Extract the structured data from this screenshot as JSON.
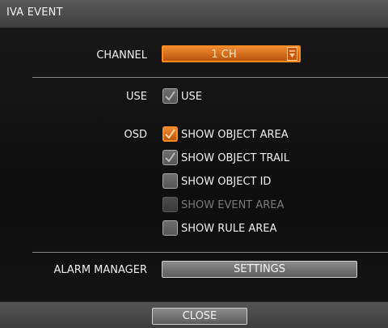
{
  "window": {
    "title": "IVA EVENT"
  },
  "channel": {
    "label": "CHANNEL",
    "value": "1 CH",
    "icon": "dropdown-arrow-icon"
  },
  "use": {
    "label": "USE",
    "option": {
      "label": "USE",
      "checked": true,
      "enabled": true
    }
  },
  "osd": {
    "label": "OSD",
    "options": [
      {
        "label": "SHOW OBJECT AREA",
        "checked": true,
        "enabled": true,
        "focused": true
      },
      {
        "label": "SHOW OBJECT TRAIL",
        "checked": true,
        "enabled": true
      },
      {
        "label": "SHOW OBJECT ID",
        "checked": false,
        "enabled": true
      },
      {
        "label": "SHOW EVENT AREA",
        "checked": false,
        "enabled": false
      },
      {
        "label": "SHOW RULE AREA",
        "checked": false,
        "enabled": true
      }
    ]
  },
  "alarm_manager": {
    "label": "ALARM MANAGER",
    "button_label": "SETTINGS"
  },
  "footer": {
    "close_label": "CLOSE"
  },
  "colors": {
    "focus": "#ff8a1e",
    "check": "#b8b8b8",
    "focus_check": "#ffd9b0"
  }
}
